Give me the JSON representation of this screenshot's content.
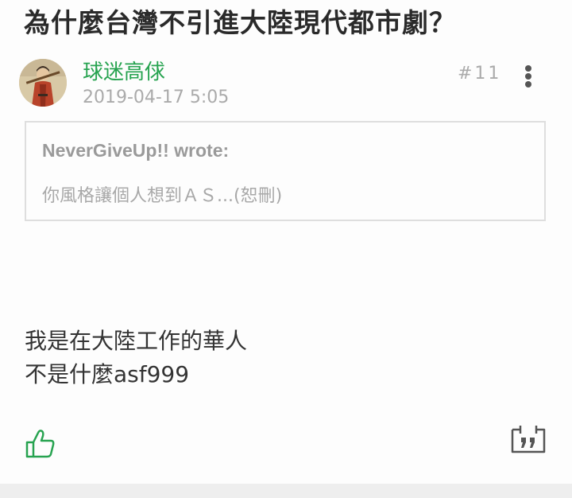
{
  "thread": {
    "title": "為什麼台灣不引進大陸現代都市劇？"
  },
  "post": {
    "username": "球迷高俅",
    "timestamp": "2019-04-17 5:05",
    "number": "#11",
    "quote": {
      "author": "NeverGiveUp!! wrote:",
      "text": "你風格讓個人想到ＡＳ...(恕刪)"
    },
    "body_lines": [
      "我是在大陸工作的華人",
      "不是什麼asf999"
    ]
  },
  "colors": {
    "username": "#27a350",
    "like_icon": "#27a350",
    "meta": "#aaaaaa",
    "quote_border": "#dedede"
  },
  "icons": {
    "more": "vertical-dots-icon",
    "like": "thumbs-up-icon",
    "quote": "quote-icon"
  }
}
